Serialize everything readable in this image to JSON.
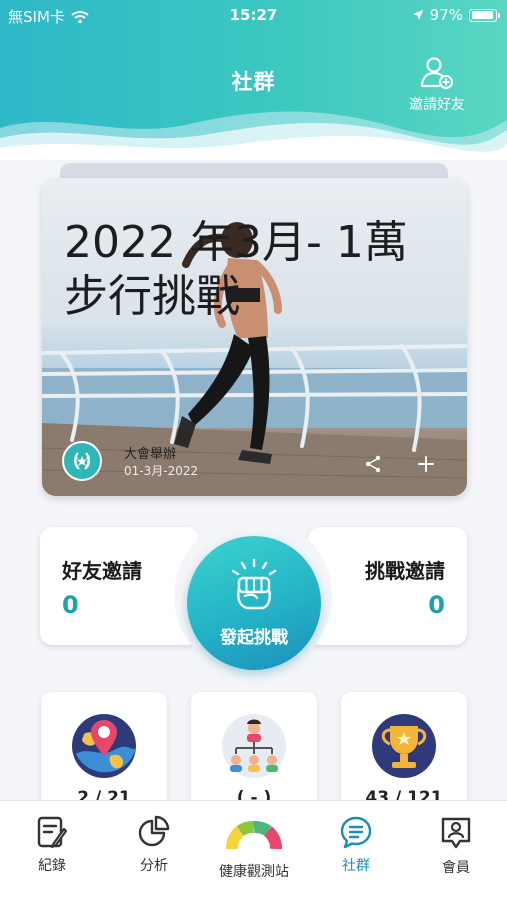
{
  "status_bar": {
    "carrier": "無SIM卡",
    "time": "15:27",
    "battery": "97%",
    "battery_level": 0.97
  },
  "header": {
    "title": "社群",
    "invite_label": "邀請好友"
  },
  "hero": {
    "title": "2022 年3月- 1萬步行挑戰",
    "organizer": "大會舉辦",
    "date": "01-3月-2022"
  },
  "challenge": {
    "friend_invites_label": "好友邀請",
    "friend_invites_count": "0",
    "challenge_invites_label": "挑戰邀請",
    "challenge_invites_count": "0",
    "launch_label": "發起挑戰"
  },
  "tiles": [
    {
      "icon": "location-globe-icon",
      "value": "2 / 21"
    },
    {
      "icon": "group-hierarchy-icon",
      "value": "( - )"
    },
    {
      "icon": "trophy-icon",
      "value": "43 / 121"
    }
  ],
  "tabs": [
    {
      "label": "紀錄",
      "icon": "record-icon",
      "active": false
    },
    {
      "label": "分析",
      "icon": "pie-chart-icon",
      "active": false
    },
    {
      "label": "健康觀測站",
      "icon": "gauge-icon",
      "active": false
    },
    {
      "label": "社群",
      "icon": "chat-icon",
      "active": true
    },
    {
      "label": "會員",
      "icon": "member-icon",
      "active": false
    }
  ],
  "colors": {
    "accent": "#1a8fb0",
    "teal": "#2fb8c8",
    "count": "#1ba3ad"
  }
}
